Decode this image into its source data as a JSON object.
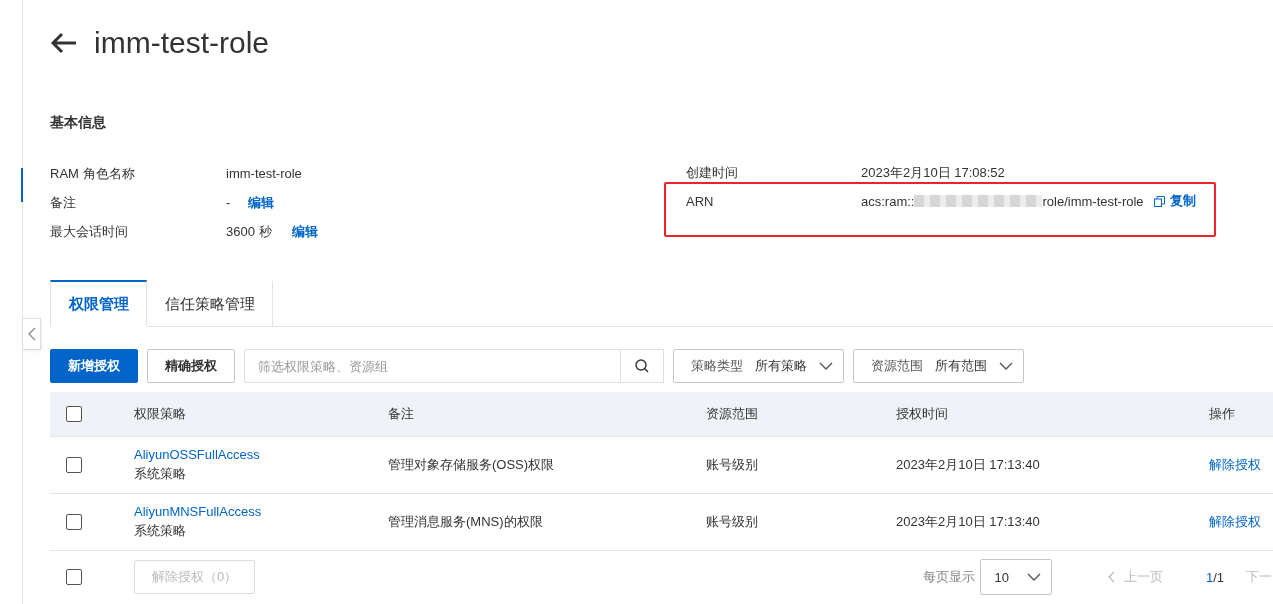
{
  "header": {
    "title": "imm-test-role"
  },
  "basic_info": {
    "heading": "基本信息",
    "left": [
      {
        "label": "RAM 角色名称",
        "value": "imm-test-role"
      },
      {
        "label": "备注",
        "value": "-",
        "link": "编辑"
      },
      {
        "label": "最大会话时间",
        "value": "3600 秒",
        "link": "编辑"
      }
    ],
    "right": [
      {
        "label": "创建时间",
        "value": "2023年2月10日 17:08:52"
      }
    ],
    "arn": {
      "label": "ARN",
      "value_prefix": "acs:ram::",
      "value_suffix": "role/imm-test-role",
      "copy": "复制",
      "highlighted": true
    }
  },
  "tabs": [
    {
      "label": "权限管理",
      "selected": true
    },
    {
      "label": "信任策略管理",
      "selected": false
    }
  ],
  "toolbar": {
    "primary_button": "新增授权",
    "secondary_button": "精确授权",
    "search": {
      "placeholder": "筛选权限策略、资源组"
    },
    "filters": [
      {
        "label": "策略类型",
        "value": "所有策略"
      },
      {
        "label": "资源范围",
        "value": "所有范围"
      }
    ]
  },
  "table": {
    "select_all": {
      "checked": false
    },
    "columns": [
      "权限策略",
      "备注",
      "资源范围",
      "授权时间",
      "操作"
    ],
    "rows": [
      {
        "checked": false,
        "policy": "AliyunOSSFullAccess",
        "policy_type": "系统策略",
        "remark": "管理对象存储服务(OSS)权限",
        "scope": "账号级别",
        "time": "2023年2月10日 17:13:40",
        "action": "解除授权"
      },
      {
        "checked": false,
        "policy": "AliyunMNSFullAccess",
        "policy_type": "系统策略",
        "remark": "管理消息服务(MNS)的权限",
        "scope": "账号级别",
        "time": "2023年2月10日 17:13:40",
        "action": "解除授权"
      }
    ]
  },
  "footer": {
    "select_all": {
      "checked": false
    },
    "bulk_button": {
      "label": "解除授权（0）",
      "disabled": true
    },
    "pagination": {
      "page_size_label": "每页显示",
      "page_size": "10",
      "prev": "上一页",
      "current": "1",
      "total": "/1",
      "next": "下一"
    }
  }
}
